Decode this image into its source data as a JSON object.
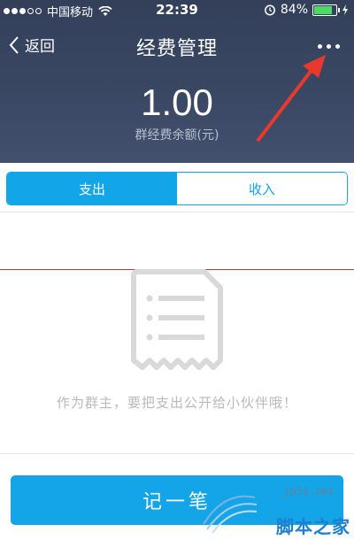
{
  "status_bar": {
    "carrier": "中国移动",
    "time": "22:39",
    "battery_percent": "84%",
    "battery_level": 0.84,
    "icons": [
      "signal-dots",
      "wifi-icon",
      "alarm-icon",
      "battery-icon",
      "charging-icon"
    ]
  },
  "nav": {
    "back_label": "返回",
    "title": "经费管理",
    "more_icon": "more-dots-icon"
  },
  "balance": {
    "amount": "1.00",
    "label": "群经费余额(元)"
  },
  "tabs": [
    {
      "label": "支出",
      "active": true
    },
    {
      "label": "收入",
      "active": false
    }
  ],
  "empty_state": {
    "icon": "receipt-icon",
    "message": "作为群主，要把支出公开给小伙伴哦！"
  },
  "record_button_label": "记一笔",
  "watermark": {
    "site": "jb51.net",
    "brand": "脚本之家"
  },
  "colors": {
    "header_bg": "#3a4763",
    "accent": "#12a5e8",
    "annotation_arrow": "#e8392e"
  }
}
